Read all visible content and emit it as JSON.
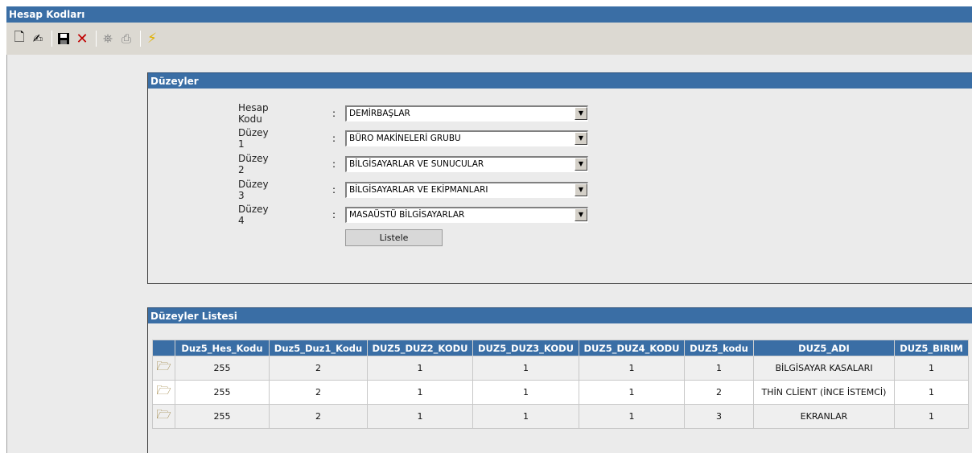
{
  "window": {
    "title": "Hesap Kodları"
  },
  "toolbar": {
    "icons": [
      "new-icon",
      "edit-icon",
      "save-icon",
      "delete-icon",
      "find-icon",
      "print-icon",
      "run-icon"
    ]
  },
  "levels_panel": {
    "title": "Düzeyler",
    "fields": [
      {
        "label": "Hesap Kodu",
        "colon": ":",
        "value": "DEMİRBAŞLAR"
      },
      {
        "label": "Düzey 1",
        "colon": ":",
        "value": "BÜRO MAKİNELERİ GRUBU"
      },
      {
        "label": "Düzey 2",
        "colon": ":",
        "value": "BİLGİSAYARLAR VE SUNUCULAR"
      },
      {
        "label": "Düzey 3",
        "colon": ":",
        "value": "BİLGİSAYARLAR VE EKİPMANLARI"
      },
      {
        "label": "Düzey 4",
        "colon": ":",
        "value": "MASAÜSTÜ BİLGİSAYARLAR"
      }
    ],
    "list_button": "Listele"
  },
  "list_panel": {
    "title": "Düzeyler Listesi",
    "columns": [
      "Duz5_Hes_Kodu",
      "Duz5_Duz1_Kodu",
      "DUZ5_DUZ2_KODU",
      "DUZ5_DUZ3_KODU",
      "DUZ5_DUZ4_KODU",
      "DUZ5_kodu",
      "DUZ5_ADI",
      "DUZ5_BIRIM"
    ],
    "rows": [
      [
        "255",
        "2",
        "1",
        "1",
        "1",
        "1",
        "BİLGİSAYAR KASALARI",
        "1"
      ],
      [
        "255",
        "2",
        "1",
        "1",
        "1",
        "2",
        "THİN CLİENT (İNCE İSTEMCİ)",
        "1"
      ],
      [
        "255",
        "2",
        "1",
        "1",
        "1",
        "3",
        "EKRANLAR",
        "1"
      ]
    ]
  },
  "colors": {
    "header_blue": "#3a6ea5",
    "panel_bg": "#ebebeb",
    "toolbar_bg": "#dcd9d2"
  }
}
